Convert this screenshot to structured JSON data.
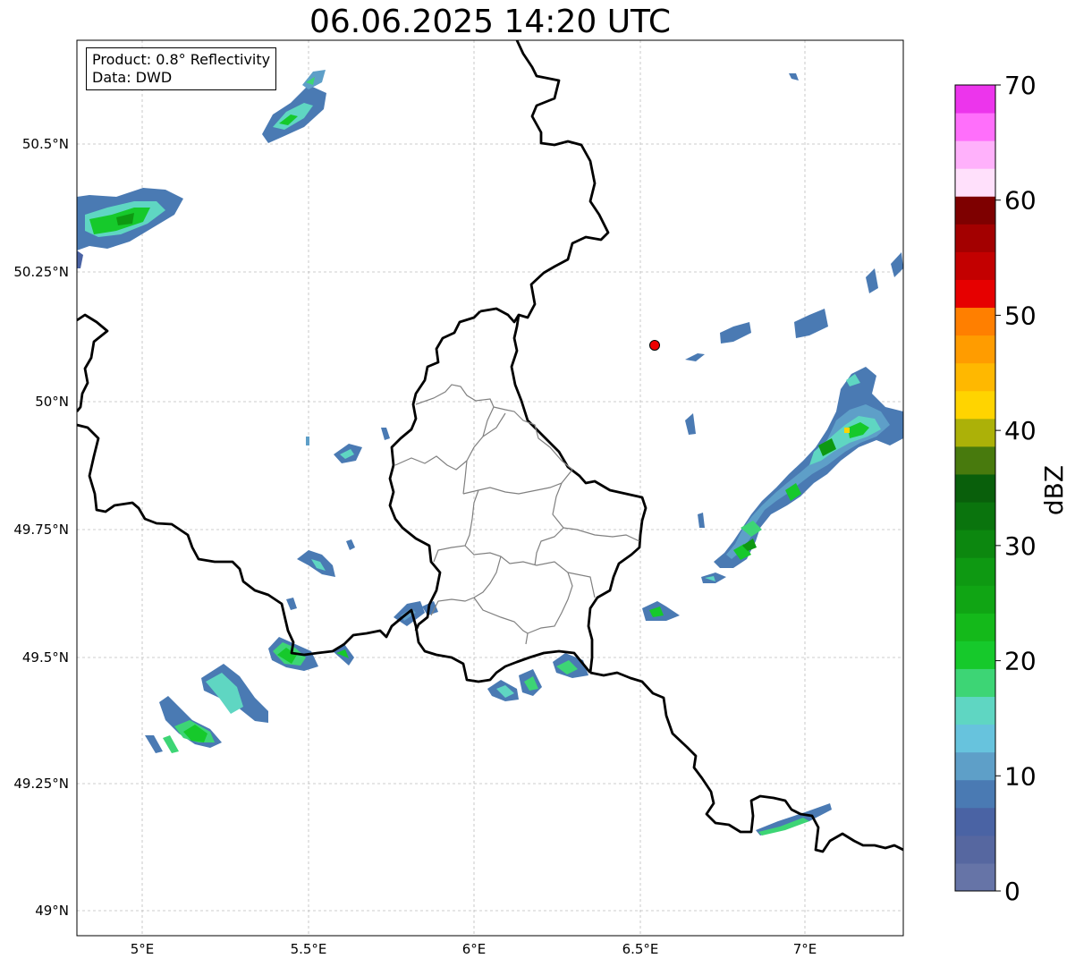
{
  "title": "06.06.2025 14:20 UTC",
  "info_box": {
    "product": "Product: 0.8° Reflectivity",
    "data": "Data: DWD"
  },
  "axes": {
    "lon_ticks": [
      "5°E",
      "5.5°E",
      "6°E",
      "6.5°E",
      "7°E"
    ],
    "lat_ticks": [
      "50.5°N",
      "50.25°N",
      "50°N",
      "49.75°N",
      "49.5°N",
      "49.25°N",
      "49°N"
    ]
  },
  "colorbar": {
    "label": "dBZ",
    "ticks": [
      "0",
      "10",
      "20",
      "30",
      "40",
      "50",
      "60",
      "70"
    ],
    "colors": [
      "#6674a7",
      "#5667a0",
      "#4a63a4",
      "#4a7ab3",
      "#5e9fc8",
      "#67c3dd",
      "#5fd6c2",
      "#3dd575",
      "#16c92b",
      "#14b91a",
      "#10a514",
      "#0e9912",
      "#0c870f",
      "#0a740d",
      "#095f0b",
      "#487a0d",
      "#acb108",
      "#ffd400",
      "#ffb800",
      "#ff9c00",
      "#ff7f00",
      "#e60000",
      "#c30000",
      "#a30000",
      "#7e0000",
      "#ffe0fb",
      "#ffb1fb",
      "#ff6ffb",
      "#ec35ec"
    ]
  },
  "radar_site_color": "#ee0000"
}
